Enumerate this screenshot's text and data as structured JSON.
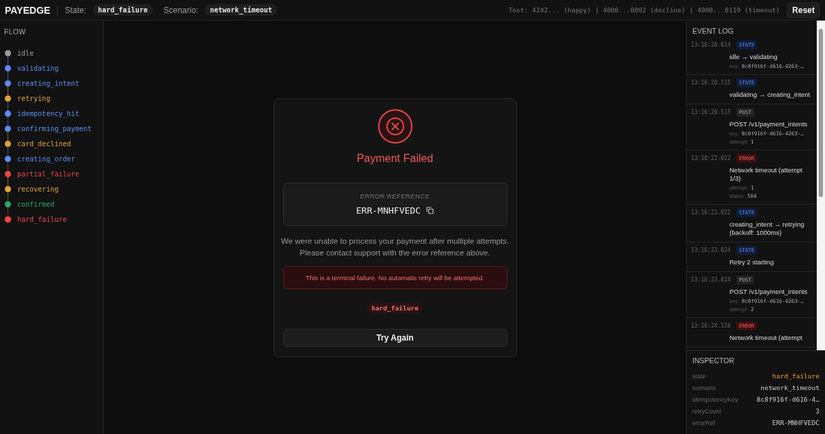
{
  "header": {
    "brand": "PAYEDGE",
    "state_label": "State:",
    "state": "hard_failure",
    "scenario_label": "Scenario:",
    "scenario": "network_timeout",
    "test_cards": "Test: 4242... (happy) | 4000...0002 (decline) | 4000...0119 (timeout)",
    "reset": "Reset"
  },
  "flow": {
    "title": "FLOW",
    "steps": [
      {
        "label": "idle",
        "color": "#9a9a9a",
        "selected": false
      },
      {
        "label": "validating",
        "color": "#5b8def",
        "selected": false
      },
      {
        "label": "creating_intent",
        "color": "#5b8def",
        "selected": false
      },
      {
        "label": "retrying",
        "color": "#e0a13a",
        "selected": false
      },
      {
        "label": "idempotency_hit",
        "color": "#5b8def",
        "selected": false
      },
      {
        "label": "confirming_payment",
        "color": "#5b8def",
        "selected": false
      },
      {
        "label": "card_declined",
        "color": "#e0a13a",
        "selected": false
      },
      {
        "label": "creating_order",
        "color": "#5b8def",
        "selected": false
      },
      {
        "label": "partial_failure",
        "color": "#e5484d",
        "selected": false
      },
      {
        "label": "recovering",
        "color": "#e0a13a",
        "selected": false
      },
      {
        "label": "confirmed",
        "color": "#30a46c",
        "selected": false
      },
      {
        "label": "hard_failure",
        "color": "#e5484d",
        "selected": true
      }
    ]
  },
  "dialog": {
    "title": "Payment Failed",
    "ref_label": "ERROR REFERENCE",
    "ref": "ERR-MNHFVEDC",
    "message": "We were unable to process your payment after multiple attempts. Please contact support with the error reference above.",
    "notice": "This is a terminal failure. No automatic retry will be attempted.",
    "state_tag": "hard_failure",
    "button": "Try Again"
  },
  "event_log": {
    "title": "EVENT LOG",
    "events": [
      {
        "time": "13:16:20.014",
        "kind": "state",
        "tag": "STATE",
        "message": "idle → validating",
        "details": [
          {
            "label": "key:",
            "value": "8c8f916f-d616-4263-…"
          }
        ]
      },
      {
        "time": "13:16:20.515",
        "kind": "state",
        "tag": "STATE",
        "message": "validating → creating_intent"
      },
      {
        "time": "13:16:20.515",
        "kind": "post",
        "tag": "POST",
        "message": "POST /v1/payment_intents",
        "details": [
          {
            "label": "key:",
            "value": "8c8f916f-d616-4263-…"
          },
          {
            "label": "attempt:",
            "value": "1"
          }
        ]
      },
      {
        "time": "13:16:22.022",
        "kind": "error",
        "tag": "ERROR",
        "message": "Network timeout (attempt 1/3)",
        "details": [
          {
            "label": "attempt:",
            "value": "1"
          },
          {
            "label": "status:",
            "value": "504"
          }
        ]
      },
      {
        "time": "13:16:22.022",
        "kind": "state",
        "tag": "STATE",
        "message": "creating_intent → retrying (backoff: 1000ms)"
      },
      {
        "time": "13:16:23.024",
        "kind": "state",
        "tag": "STATE",
        "message": "Retry 2 starting"
      },
      {
        "time": "13:16:23.024",
        "kind": "post",
        "tag": "POST",
        "message": "POST /v1/payment_intents",
        "details": [
          {
            "label": "key:",
            "value": "8c8f916f-d616-4263-…"
          },
          {
            "label": "attempt:",
            "value": "2"
          }
        ]
      },
      {
        "time": "13:16:24.528",
        "kind": "error",
        "tag": "ERROR",
        "message": "Network timeout (attempt"
      }
    ]
  },
  "inspector": {
    "title": "INSPECTOR",
    "rows": [
      {
        "label": "state",
        "value": "hard_failure",
        "accent": true
      },
      {
        "label": "scenario",
        "value": "network_timeout",
        "accent": false
      },
      {
        "label": "idempotencyKey",
        "value": "8c8f916f-d616-4…",
        "accent": false
      },
      {
        "label": "retryCount",
        "value": "3",
        "accent": false
      },
      {
        "label": "errorRef",
        "value": "ERR-MNHFVEDC",
        "accent": false
      }
    ]
  }
}
